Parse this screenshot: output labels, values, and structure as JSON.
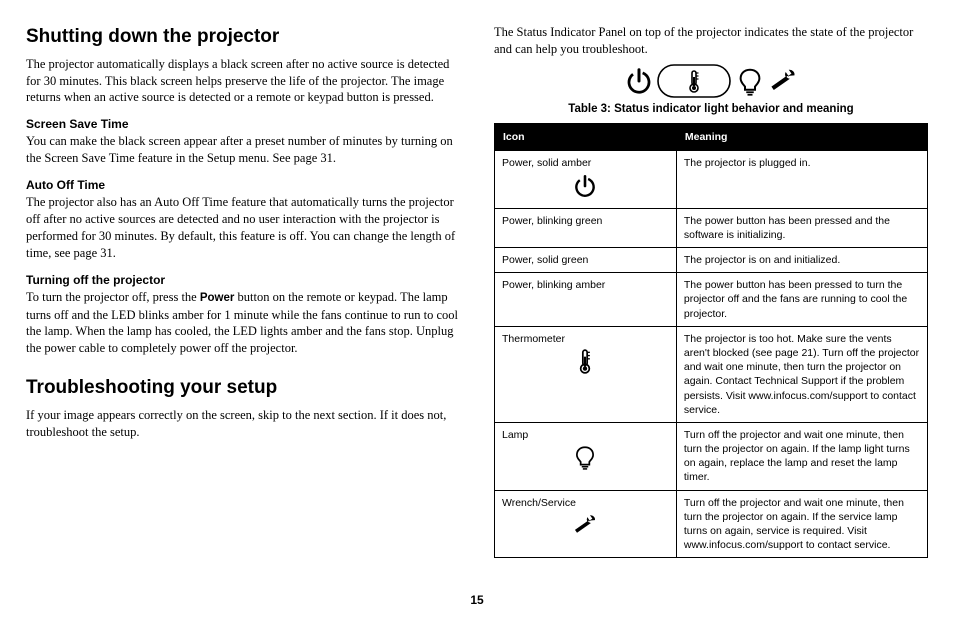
{
  "left": {
    "h_shutdown": "Shutting down the projector",
    "p_shutdown": "The projector automatically displays a black screen after no active source is detected for 30 minutes. This black screen helps preserve the life of the projector. The image returns when an active source is detected or a remote or keypad button is pressed.",
    "sub_screen": "Screen Save Time",
    "p_screen": "You can make the black screen appear after a preset number of minutes by turning on the Screen Save Time feature in the Setup menu. See page 31.",
    "sub_auto": "Auto Off Time",
    "p_auto": "The projector also has an Auto Off Time feature that automatically turns the projector off after no active sources are detected and no user interaction with the projector is performed for 30 minutes. By default, this feature is off. You can change the length of time, see page 31.",
    "sub_turnoff": "Turning off the projector",
    "p_turnoff_a": "To turn the projector off, press the ",
    "p_turnoff_bold": "Power",
    "p_turnoff_b": " button on the remote or keypad. The lamp turns off and the LED blinks amber for 1 minute while the fans continue to run to cool the lamp. When the lamp has cooled, the LED lights amber and the fans stop. Unplug the power cable to completely power off the projector.",
    "h_trouble": "Troubleshooting your setup",
    "p_trouble": "If your image appears correctly on the screen, skip to the next section. If it does not, troubleshoot the setup."
  },
  "right": {
    "intro": "The Status Indicator Panel on top of the projector indicates the state of the projector and can help you troubleshoot.",
    "caption": "Table 3: Status indicator light behavior and meaning",
    "th_icon": "Icon",
    "th_meaning": "Meaning",
    "rows": [
      {
        "icon_label": "Power, solid amber",
        "show_icon": "power",
        "meaning": "The projector is plugged in."
      },
      {
        "icon_label": "Power, blinking green",
        "show_icon": "",
        "meaning": "The power button has been pressed and the software is initializing."
      },
      {
        "icon_label": "Power, solid green",
        "show_icon": "",
        "meaning": "The projector is on and initialized."
      },
      {
        "icon_label": "Power, blinking amber",
        "show_icon": "",
        "meaning": "The power button has been pressed to turn the projector off and the fans are running to cool the projector."
      },
      {
        "icon_label": "Thermometer",
        "show_icon": "thermo",
        "meaning": "The projector is too hot. Make sure the vents aren't blocked (see page 21). Turn off the projector and wait one minute, then turn the projector on again. Contact Technical Support if the problem persists. Visit www.infocus.com/support to contact service."
      },
      {
        "icon_label": "Lamp",
        "show_icon": "lamp",
        "meaning": "Turn off the projector and wait one minute, then turn the projector on again. If the lamp light turns on again, replace the lamp and reset the lamp timer."
      },
      {
        "icon_label": "Wrench/Service",
        "show_icon": "wrench",
        "meaning": "Turn off the projector and wait one minute, then turn the projector on again. If the service lamp turns on again, service is required. Visit www.infocus.com/support to contact service."
      }
    ]
  },
  "page_number": "15"
}
